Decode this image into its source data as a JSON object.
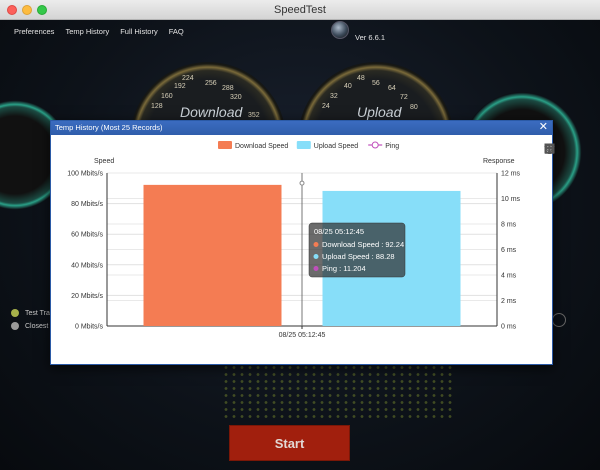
{
  "window": {
    "title": "SpeedTest"
  },
  "menu": [
    "Preferences",
    "Temp History",
    "Full History",
    "FAQ"
  ],
  "version": "Ver 6.6.1",
  "gauges": {
    "download": {
      "label": "Download",
      "ticks": [
        "128",
        "160",
        "192",
        "224",
        "256",
        "288",
        "320",
        "352"
      ]
    },
    "upload": {
      "label": "Upload",
      "ticks": [
        "24",
        "32",
        "40",
        "48",
        "56",
        "64",
        "72",
        "80"
      ]
    }
  },
  "legend_bg": [
    "Test Tra",
    "Closest"
  ],
  "start_button": "Start",
  "dialog": {
    "title": "Temp History (Most 25 Records)",
    "close": "✕",
    "toolbox": [
      "zoom-icon",
      "zoom-reset-icon",
      "line-icon",
      "bar-icon",
      "stack-icon",
      "tiled-icon",
      "restore-icon"
    ]
  },
  "chart_data": {
    "type": "bar",
    "categories": [
      "08/25 05:12:45"
    ],
    "series": [
      {
        "name": "Download Speed",
        "type": "bar",
        "axis": "left",
        "values": [
          92.24
        ],
        "color": "#f47c53"
      },
      {
        "name": "Upload Speed",
        "type": "bar",
        "axis": "left",
        "values": [
          88.28
        ],
        "color": "#87def9"
      },
      {
        "name": "Ping",
        "type": "line",
        "axis": "right",
        "values": [
          11.204
        ],
        "color": "#c04fbc"
      }
    ],
    "yLeft": {
      "label": "Speed",
      "min": 0,
      "max": 100,
      "ticks": [
        0,
        20,
        40,
        60,
        80,
        100
      ],
      "unit": "Mbits/s"
    },
    "yRight": {
      "label": "Response",
      "min": 0,
      "max": 12,
      "ticks": [
        0,
        2,
        4,
        6,
        8,
        10,
        12
      ],
      "unit": "ms"
    },
    "grid": true,
    "legend_position": "top-center",
    "tooltip": {
      "title": "08/25 05:12:45",
      "rows": [
        "Download Speed : 92.24",
        "Upload Speed : 88.28",
        "Ping : 11.204"
      ]
    }
  }
}
